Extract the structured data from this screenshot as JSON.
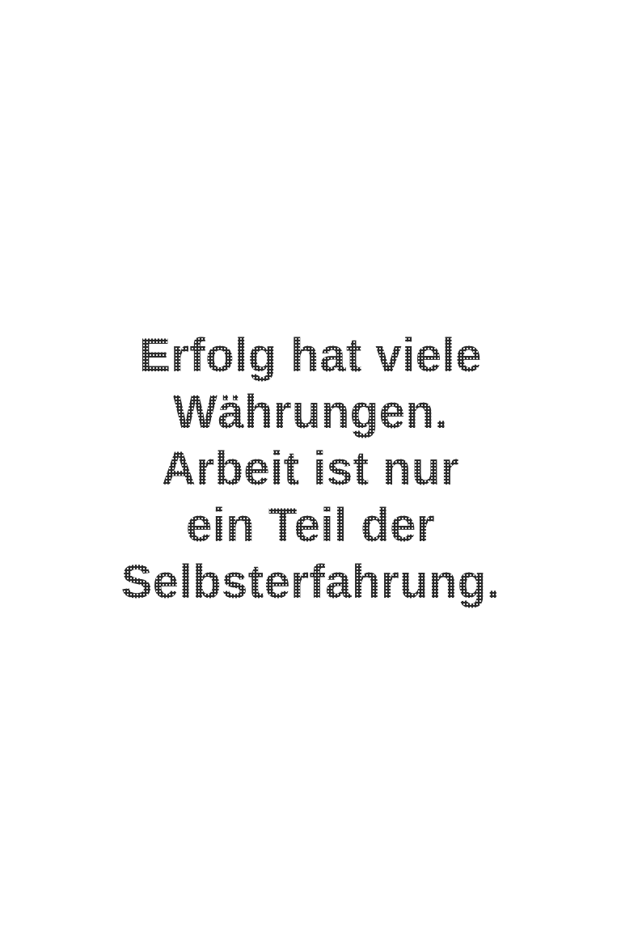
{
  "quote": {
    "lines": [
      "Erfolg hat viele",
      "Währungen.",
      "Arbeit ist nur",
      "ein Teil der",
      "Selbsterfahrung."
    ],
    "text_color": "#2a2a2a",
    "background_color": "#ffffff"
  }
}
